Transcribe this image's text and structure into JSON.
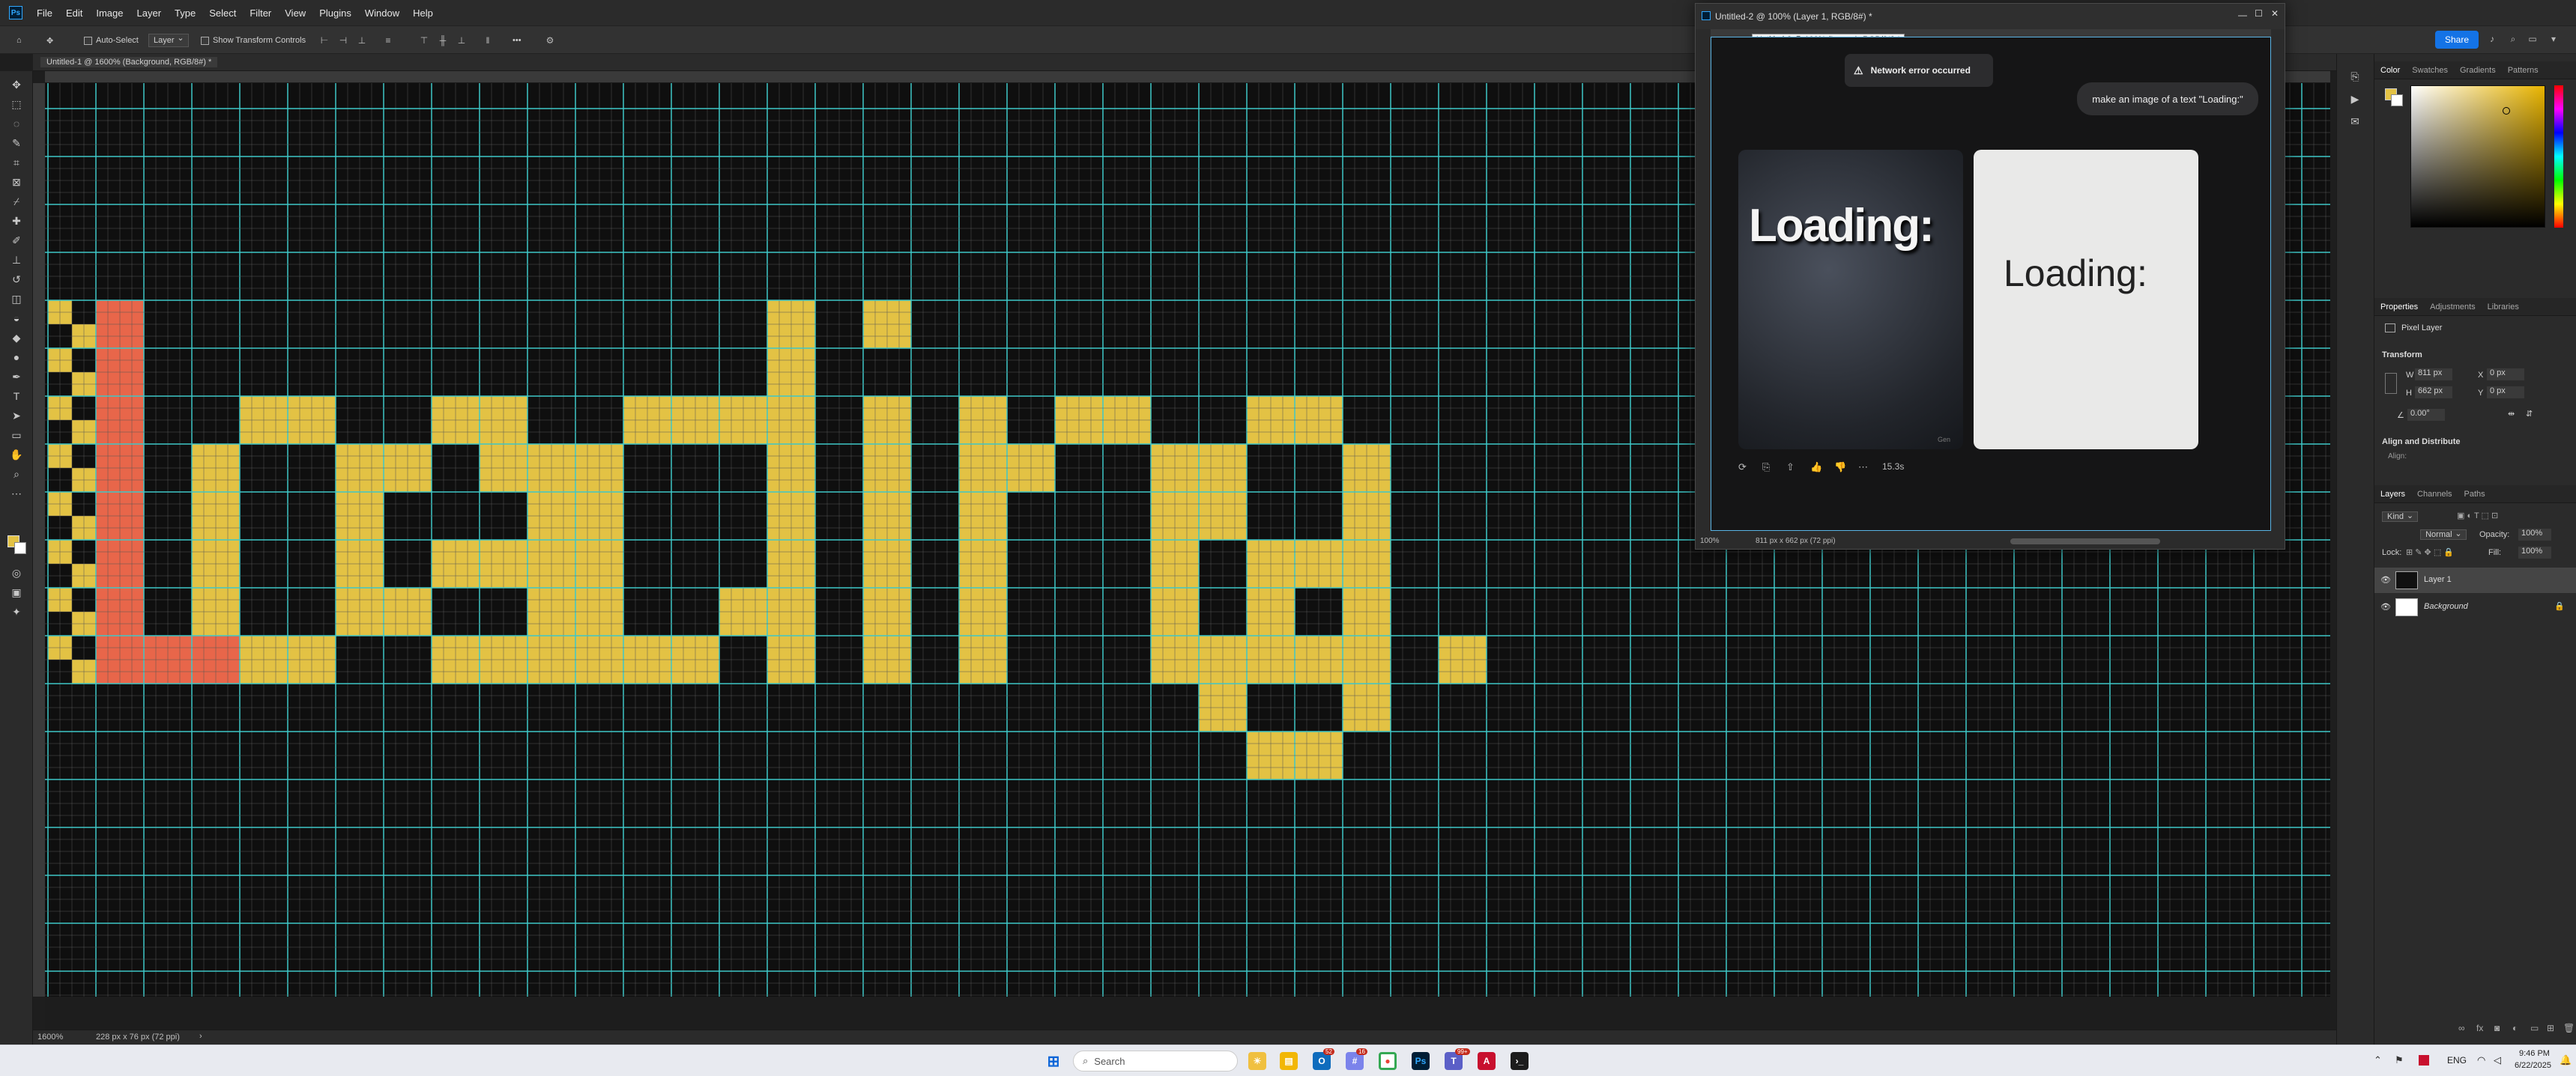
{
  "app": {
    "menus": [
      "File",
      "Edit",
      "Image",
      "Layer",
      "Type",
      "Select",
      "Filter",
      "View",
      "Plugins",
      "Window",
      "Help"
    ]
  },
  "options_bar": {
    "auto_select_label": "Auto-Select",
    "auto_select_target": "Layer",
    "show_transform_label": "Show Transform Controls",
    "more_label": "•••",
    "share_label": "Share"
  },
  "document": {
    "tab_title": "Untitled-1 @ 1600% (Background, RGB/8#) *",
    "zoom": "1600%",
    "doc_size": "228 px x 76 px (72 ppi)",
    "canvas_text": "Loading:",
    "pixel_colors": {
      "accent_letter": "#e8664a",
      "letters": "#e3c244",
      "grid": "#3ec8c8"
    }
  },
  "floating_window": {
    "title": "Untitled-2 @ 100% (Layer 1, RGB/8#) *",
    "tooltip": "Untitled-2 @ 100% (Layer 1, RGB/8#) *",
    "error_toast": "Network error occurred",
    "prompt_bubble": "make an image of a text \"Loading:\"",
    "image1_text": "Loading:",
    "image2_text": "Loading:",
    "image1_badge": "Gen",
    "gen_time": "15.3s",
    "zoom": "100%",
    "doc_size": "811 px x 662 px (72 ppi)"
  },
  "panels": {
    "color_tabs": [
      "Color",
      "Swatches",
      "Gradients",
      "Patterns"
    ],
    "props_tabs": [
      "Properties",
      "Adjustments",
      "Libraries"
    ],
    "layer_kind": "Pixel Layer",
    "transform_label": "Transform",
    "w_label": "W",
    "w_value": "811 px",
    "h_label": "H",
    "h_value": "662 px",
    "x_label": "X",
    "x_value": "0 px",
    "y_label": "Y",
    "y_value": "0 px",
    "angle_value": "0.00°",
    "align_label": "Align and Distribute",
    "align_sub": "Align:",
    "layers_tabs": [
      "Layers",
      "Channels",
      "Paths"
    ],
    "kind_filter": "Kind",
    "blend_mode": "Normal",
    "opacity_label": "Opacity:",
    "opacity_value": "100%",
    "lock_label": "Lock:",
    "fill_label": "Fill:",
    "fill_value": "100%",
    "layers": [
      {
        "name": "Layer 1"
      },
      {
        "name": "Background"
      }
    ]
  },
  "taskbar": {
    "search_placeholder": "Search",
    "lang": "ENG",
    "time": "9:46 PM",
    "date": "6/22/2025",
    "badge_outlook": "52",
    "badge_teams": "16",
    "badge_chat": "99+"
  }
}
